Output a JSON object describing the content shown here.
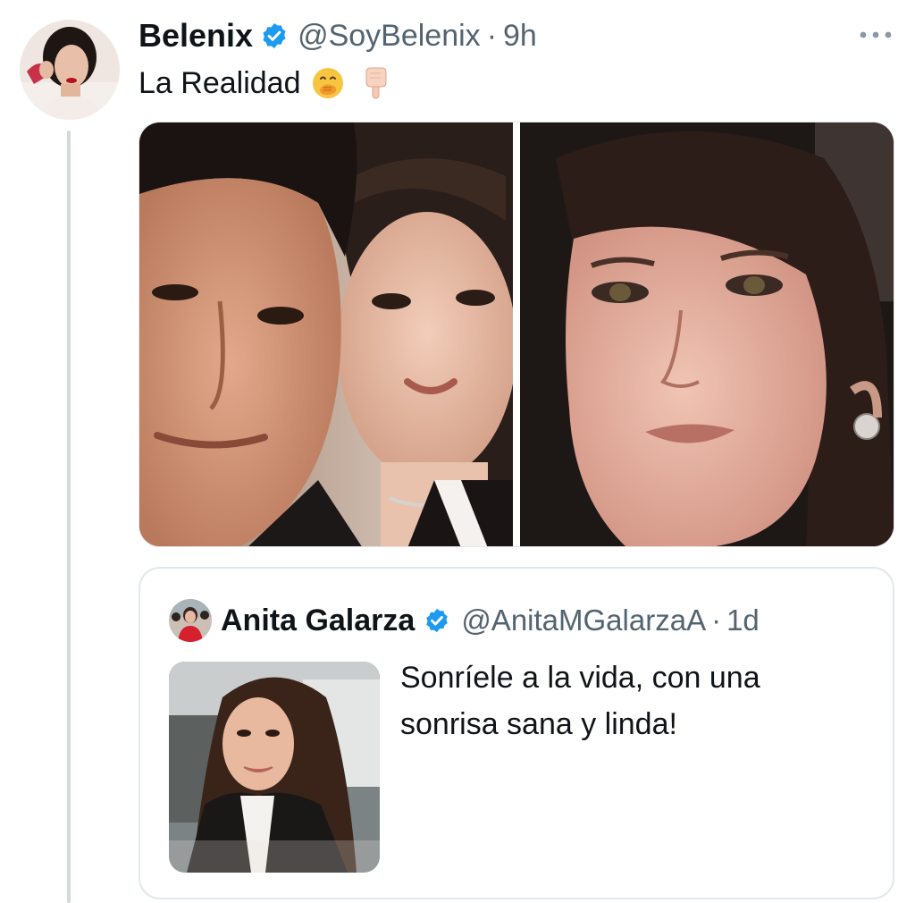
{
  "tweet": {
    "author": {
      "display_name": "Belenix",
      "handle": "@SoyBelenix",
      "verified": true,
      "avatar_icon": "profile-photo"
    },
    "separator": "·",
    "time": "9h",
    "text": "La Realidad",
    "emojis": [
      "face-with-hand-over-mouth",
      "backhand-index-pointing-down"
    ],
    "more_icon": "ellipsis-icon",
    "media": [
      "photo-couple-selfie",
      "photo-woman-closeup"
    ]
  },
  "quoted_tweet": {
    "author": {
      "display_name": "Anita Galarza",
      "handle": "@AnitaMGalarzaA",
      "verified": true
    },
    "separator": "·",
    "time": "1d",
    "text_lines": [
      "Sonríele a la vida, con una",
      "sonrisa sana y linda!"
    ],
    "media": "photo-woman-car-selfie"
  },
  "colors": {
    "text_primary": "#0f1419",
    "text_secondary": "#536471",
    "verified_blue": "#1d9bf0",
    "border": "#e1e8ed",
    "thread_line": "#cfd9de"
  }
}
